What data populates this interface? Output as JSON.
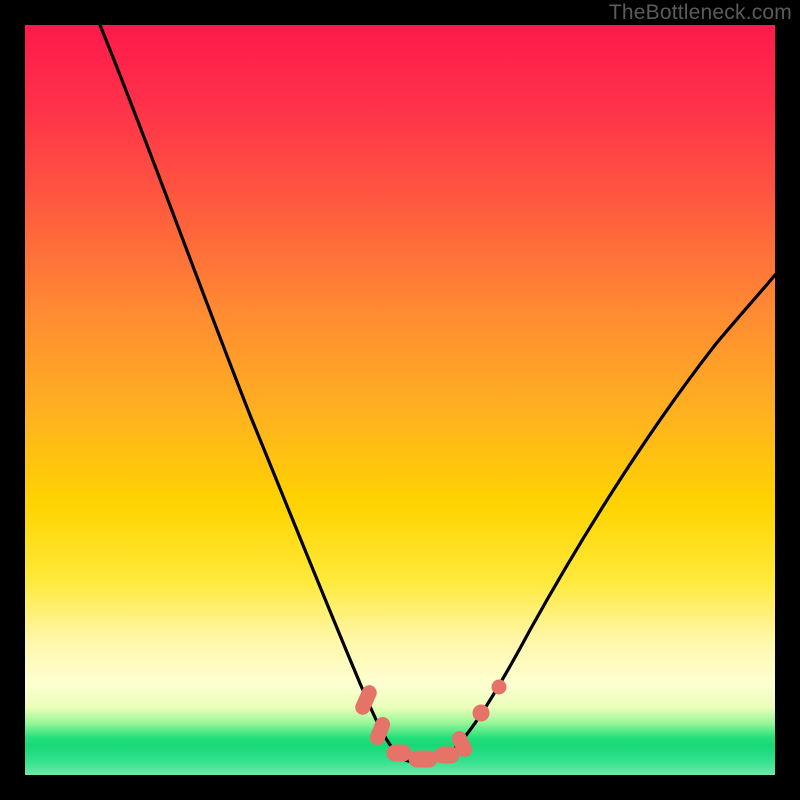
{
  "watermark": {
    "text": "TheBottleneck.com"
  },
  "chart_data": {
    "type": "line",
    "title": "",
    "xlabel": "",
    "ylabel": "",
    "xlim": [
      0,
      100
    ],
    "ylim": [
      0,
      100
    ],
    "grid": false,
    "legend": false,
    "background_gradient": {
      "top": "#ff1a4b",
      "mid": "#ffd400",
      "bottom_band": "#17d877"
    },
    "series": [
      {
        "name": "bottleneck-curve",
        "color": "#000000",
        "x": [
          10,
          14,
          18,
          22,
          26,
          30,
          34,
          38,
          42,
          45,
          47,
          49,
          51,
          53,
          55,
          57,
          59,
          62,
          66,
          72,
          80,
          90,
          100
        ],
        "y": [
          100,
          88,
          76,
          64,
          53,
          43,
          34,
          25,
          17,
          11,
          7,
          4,
          2,
          2,
          2,
          4,
          6,
          10,
          17,
          27,
          40,
          54,
          67
        ]
      }
    ],
    "markers": {
      "name": "valley-markers",
      "color": "#e57368",
      "points": [
        {
          "x": 45.0,
          "y": 11
        },
        {
          "x": 46.5,
          "y": 7
        },
        {
          "x": 49.0,
          "y": 3
        },
        {
          "x": 51.0,
          "y": 2
        },
        {
          "x": 53.0,
          "y": 2
        },
        {
          "x": 55.0,
          "y": 2
        },
        {
          "x": 57.0,
          "y": 4
        },
        {
          "x": 58.5,
          "y": 6
        },
        {
          "x": 61.0,
          "y": 10
        },
        {
          "x": 62.5,
          "y": 13
        }
      ]
    }
  }
}
